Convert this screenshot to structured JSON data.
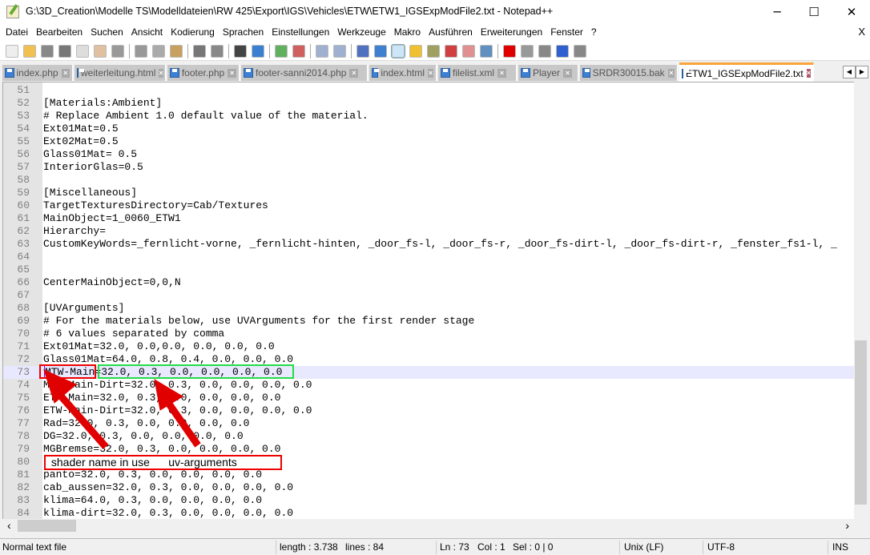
{
  "window": {
    "title": "G:\\3D_Creation\\Modelle TS\\Modelldateien\\RW 425\\Export\\IGS\\Vehicles\\ETW\\ETW1_IGSExpModFile2.txt - Notepad++",
    "minimize": "─",
    "maximize": "☐",
    "close": "✕"
  },
  "menu": {
    "items": [
      "Datei",
      "Bearbeiten",
      "Suchen",
      "Ansicht",
      "Kodierung",
      "Sprachen",
      "Einstellungen",
      "Werkzeuge",
      "Makro",
      "Ausführen",
      "Erweiterungen",
      "Fenster",
      "?"
    ],
    "close": "X"
  },
  "toolbar": [
    {
      "icon": "new-file-icon",
      "color": "#eeeeee"
    },
    {
      "icon": "open-file-icon",
      "color": "#f0c050"
    },
    {
      "icon": "save-icon",
      "color": "#888888"
    },
    {
      "icon": "save-all-icon",
      "color": "#777777"
    },
    {
      "icon": "close-file-icon",
      "color": "#dddddd"
    },
    {
      "icon": "close-all-icon",
      "color": "#e0c0a0"
    },
    {
      "icon": "print-icon",
      "color": "#999999"
    },
    {
      "sep": true
    },
    {
      "icon": "cut-icon",
      "color": "#999999"
    },
    {
      "icon": "copy-icon",
      "color": "#aaaaaa"
    },
    {
      "icon": "paste-icon",
      "color": "#c8a060"
    },
    {
      "sep": true
    },
    {
      "icon": "undo-icon",
      "color": "#777777"
    },
    {
      "icon": "redo-icon",
      "color": "#888888"
    },
    {
      "sep": true
    },
    {
      "icon": "find-icon",
      "color": "#444444"
    },
    {
      "icon": "replace-icon",
      "color": "#3a80d0"
    },
    {
      "sep": true
    },
    {
      "icon": "zoom-in-icon",
      "color": "#60b060"
    },
    {
      "icon": "zoom-out-icon",
      "color": "#d06060"
    },
    {
      "sep": true
    },
    {
      "icon": "sync-vertical-icon",
      "color": "#a0b0d0"
    },
    {
      "icon": "sync-horizontal-icon",
      "color": "#a0b0d0"
    },
    {
      "sep": true
    },
    {
      "icon": "word-wrap-icon",
      "color": "#5070c0"
    },
    {
      "icon": "show-all-chars-icon",
      "color": "#4080d0"
    },
    {
      "icon": "indent-guide-icon",
      "color": "#3050d0"
    },
    {
      "icon": "user-language-icon",
      "color": "#f0c030"
    },
    {
      "icon": "document-map-icon",
      "color": "#a0a060"
    },
    {
      "icon": "function-list-icon",
      "color": "#d04040"
    },
    {
      "icon": "folder-workspace-icon",
      "color": "#e09090"
    },
    {
      "icon": "monitoring-icon",
      "color": "#6090c0"
    },
    {
      "sep": true
    },
    {
      "icon": "record-macro-icon",
      "color": "#e00000"
    },
    {
      "icon": "stop-macro-icon",
      "color": "#999999"
    },
    {
      "icon": "play-macro-icon",
      "color": "#888888"
    },
    {
      "icon": "run-macro-multiple-icon",
      "color": "#3060d0"
    },
    {
      "icon": "save-macro-icon",
      "color": "#888888"
    }
  ],
  "tabs": [
    {
      "label": "index.php"
    },
    {
      "label": "weiterleitung.html"
    },
    {
      "label": "footer.php"
    },
    {
      "label": "footer-sanni2014.php"
    },
    {
      "label": "index.html"
    },
    {
      "label": "filelist.xml"
    },
    {
      "label": "Player"
    },
    {
      "label": "SRDR30015.bak"
    },
    {
      "label": "ETW1_IGSExpModFile2.txt",
      "active": true
    }
  ],
  "tab_scroll": {
    "left": "◀",
    "right": "▶"
  },
  "editor": {
    "current_line": 73,
    "lines": [
      {
        "n": "51",
        "t": ""
      },
      {
        "n": "52",
        "t": "[Materials:Ambient]"
      },
      {
        "n": "53",
        "t": "# Replace Ambient 1.0 default value of the material."
      },
      {
        "n": "54",
        "t": "Ext01Mat=0.5"
      },
      {
        "n": "55",
        "t": "Ext02Mat=0.5"
      },
      {
        "n": "56",
        "t": "Glass01Mat= 0.5"
      },
      {
        "n": "57",
        "t": "InteriorGlas=0.5"
      },
      {
        "n": "58",
        "t": ""
      },
      {
        "n": "59",
        "t": "[Miscellaneous]"
      },
      {
        "n": "60",
        "t": "TargetTexturesDirectory=Cab/Textures"
      },
      {
        "n": "61",
        "t": "MainObject=1_0060_ETW1"
      },
      {
        "n": "62",
        "t": "Hierarchy="
      },
      {
        "n": "63",
        "t": "CustomKeyWords=_fernlicht-vorne, _fernlicht-hinten, _door_fs-l, _door_fs-r, _door_fs-dirt-l, _door_fs-dirt-r, _fenster_fs1-l, _"
      },
      {
        "n": "64",
        "t": ""
      },
      {
        "n": "65",
        "t": ""
      },
      {
        "n": "66",
        "t": "CenterMainObject=0,0,N"
      },
      {
        "n": "67",
        "t": ""
      },
      {
        "n": "68",
        "t": "[UVArguments]"
      },
      {
        "n": "69",
        "t": "# For the materials below, use UVArguments for the first render stage"
      },
      {
        "n": "70",
        "t": "# 6 values separated by comma"
      },
      {
        "n": "71",
        "t": "Ext01Mat=32.0, 0.0,0.0, 0.0, 0.0, 0.0"
      },
      {
        "n": "72",
        "t": "Glass01Mat=64.0, 0.8, 0.4, 0.0, 0.0, 0.0"
      },
      {
        "n": "73",
        "t": "MTW-Main=32.0, 0.3, 0.0, 0.0, 0.0, 0.0"
      },
      {
        "n": "74",
        "t": "MTW-Main-Dirt=32.0, 0.3, 0.0, 0.0, 0.0, 0.0"
      },
      {
        "n": "75",
        "t": "ETW-Main=32.0, 0.3, 0.0, 0.0, 0.0, 0.0"
      },
      {
        "n": "76",
        "t": "ETW-Main-Dirt=32.0, 0.3, 0.0, 0.0, 0.0, 0.0"
      },
      {
        "n": "77",
        "t": "Rad=32.0, 0.3, 0.0, 0.0, 0.0, 0.0"
      },
      {
        "n": "78",
        "t": "DG=32.0, 0.3, 0.0, 0.0, 0.0, 0.0"
      },
      {
        "n": "79",
        "t": "MGBremse=32.0, 0.3, 0.0, 0.0, 0.0, 0.0"
      },
      {
        "n": "80",
        "t": ""
      },
      {
        "n": "81",
        "t": "panto=32.0, 0.3, 0.0, 0.0, 0.0, 0.0"
      },
      {
        "n": "82",
        "t": "cab_aussen=32.0, 0.3, 0.0, 0.0, 0.0, 0.0"
      },
      {
        "n": "83",
        "t": "klima=64.0, 0.3, 0.0, 0.0, 0.0, 0.0"
      },
      {
        "n": "84",
        "t": "klima-dirt=32.0, 0.3, 0.0, 0.0, 0.0, 0.0"
      }
    ]
  },
  "annotation": {
    "label": " shader name in use      uv-arguments",
    "shader_box_color": "#e00000",
    "args_box_color": "#22dd44",
    "arrow_color": "#e00000"
  },
  "scroll": {
    "left": "‹",
    "right": "›"
  },
  "status": {
    "type": "Normal text file",
    "length": "length : 3.738",
    "lines": "lines : 84",
    "ln": "Ln : 73",
    "col": "Col : 1",
    "sel": "Sel : 0 | 0",
    "eol": "Unix (LF)",
    "encoding": "UTF-8",
    "mode": "INS"
  }
}
